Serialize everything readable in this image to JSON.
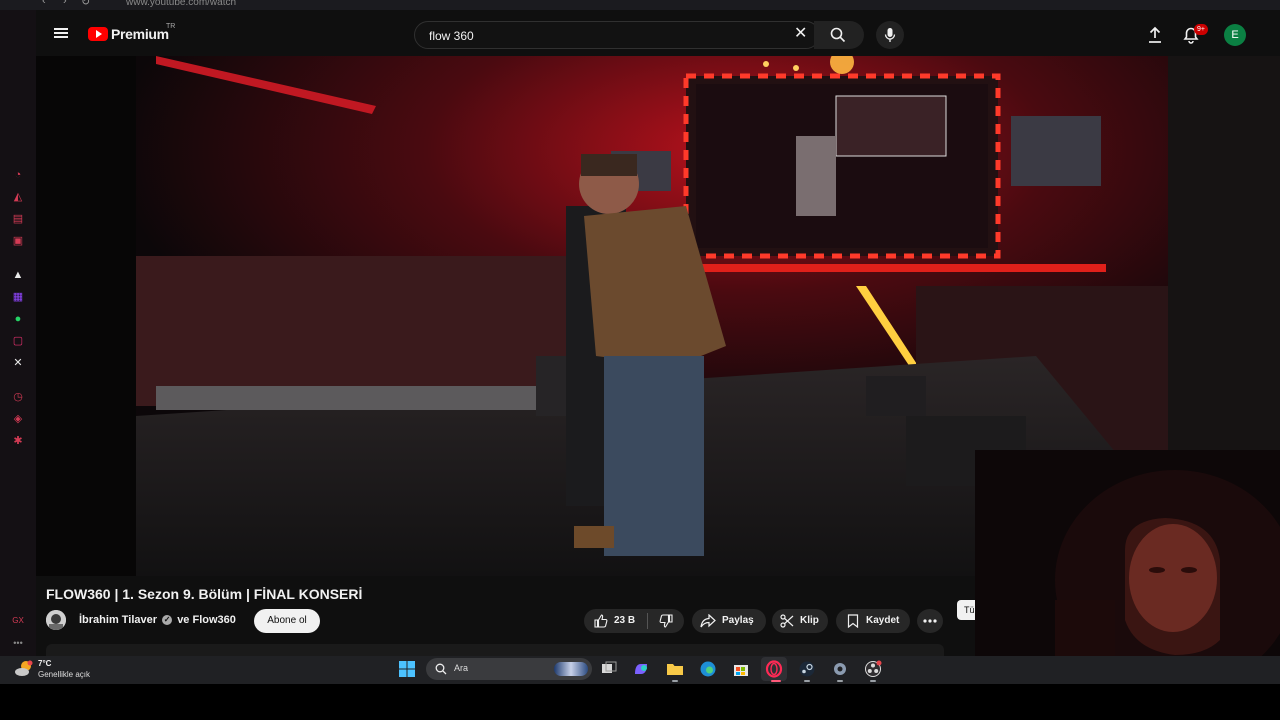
{
  "browser": {
    "url": "www.youtube.com/watch",
    "nav": [
      "‹",
      "›",
      "↻"
    ]
  },
  "header": {
    "brand": "Premium",
    "country_code": "TR",
    "search_value": "flow 360",
    "notification_badge": "9+",
    "avatar_letter": "E"
  },
  "video": {
    "title": "FLOW360 | 1. Sezon 9. Bölüm | FİNAL KONSERİ",
    "channel": "İbrahim Tilaver",
    "collab": "ve Flow360",
    "subscribe_label": "Abone ol",
    "like_count": "23 B",
    "share_label": "Paylaş",
    "clip_label": "Klip",
    "save_label": "Kaydet",
    "extra_button": "Tü"
  },
  "taskbar": {
    "weather_temp": "7°C",
    "weather_desc": "Genellikle açık",
    "search_placeholder": "Ara"
  },
  "colors": {
    "youtube_red": "#ff0000",
    "stage_red": "#e0201a",
    "opera_red": "#d43b55",
    "background": "#0f0f0f"
  }
}
